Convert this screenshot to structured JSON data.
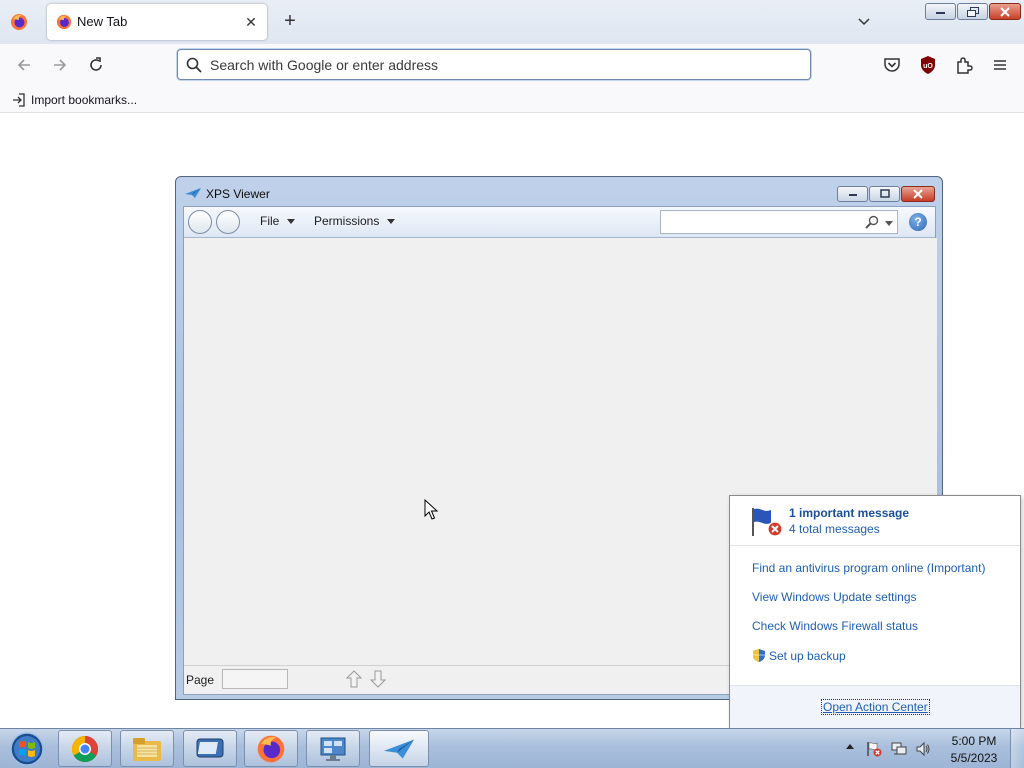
{
  "browser": {
    "tab": {
      "title": "New Tab",
      "close_glyph": "✕"
    },
    "new_tab_glyph": "+",
    "urlbar": {
      "placeholder": "Search with Google or enter address",
      "value": ""
    },
    "bookmarks": {
      "import_label": "Import bookmarks..."
    },
    "icons": [
      "firefox-icon",
      "back-icon",
      "forward-icon",
      "reload-icon",
      "search-icon",
      "pocket-icon",
      "ublock-icon",
      "extensions-icon",
      "hamburger-menu-icon",
      "tab-list-chevron-icon"
    ]
  },
  "xps_viewer": {
    "title": "XPS Viewer",
    "menus": {
      "file": "File",
      "permissions": "Permissions"
    },
    "search": {
      "value": ""
    },
    "help_glyph": "?",
    "status": {
      "page_label": "Page",
      "page_value": ""
    }
  },
  "action_center": {
    "important": "1 important message",
    "total": "4 total messages",
    "links": [
      "Find an antivirus program online (Important)",
      "View Windows Update settings",
      "Check Windows Firewall status",
      "Set up backup"
    ],
    "open_label": "Open Action Center"
  },
  "taskbar": {
    "apps": [
      "chrome",
      "windows-explorer",
      "virtual-machine",
      "firefox",
      "remote-desktop",
      "xps-viewer"
    ],
    "time": "5:00 PM",
    "date": "5/5/2023"
  },
  "colors": {
    "link_blue": "#1e5fb5",
    "taskbar": "#a9bfdc",
    "window_frame": "#a9c0df",
    "close_red": "#c9402a"
  }
}
